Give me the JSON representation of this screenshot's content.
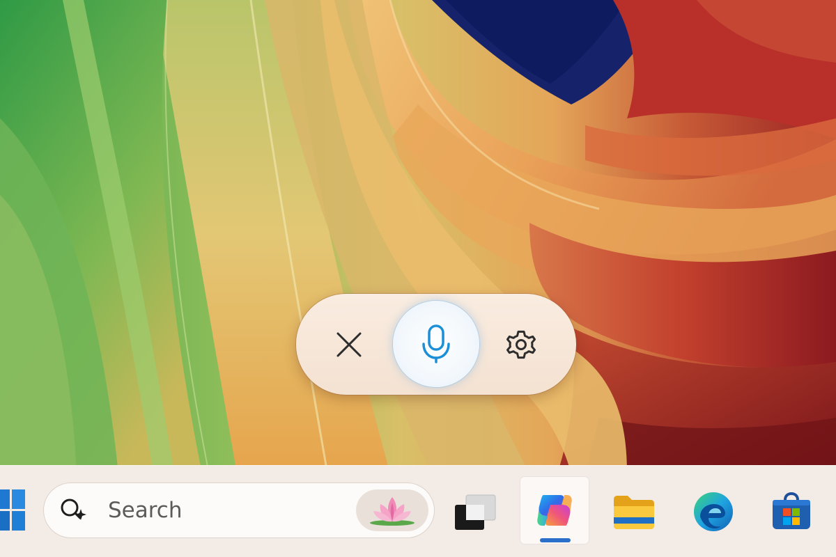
{
  "wallpaper": {
    "name": "wallpaper",
    "colors": [
      "#5cae4e",
      "#e3b965",
      "#c0342a",
      "#1c2670"
    ]
  },
  "voice_access": {
    "buttons": [
      {
        "name": "close-button",
        "icon": "close-icon"
      },
      {
        "name": "microphone-button",
        "icon": "microphone-icon",
        "state": "active"
      },
      {
        "name": "settings-button",
        "icon": "gear-icon"
      }
    ],
    "accent_color": "#1d8fd6"
  },
  "taskbar": {
    "search": {
      "placeholder": "Search",
      "icon": "copilot-search-icon",
      "highlight_icon": "lotus-icon"
    },
    "apps": [
      {
        "name": "task-view",
        "icon": "task-view-icon"
      },
      {
        "name": "copilot",
        "icon": "copilot-icon",
        "active": true
      },
      {
        "name": "file-explorer",
        "icon": "folder-icon"
      },
      {
        "name": "edge",
        "icon": "edge-icon"
      },
      {
        "name": "microsoft-store",
        "icon": "store-icon"
      }
    ],
    "active_indicator_color": "#2a6fc9"
  }
}
